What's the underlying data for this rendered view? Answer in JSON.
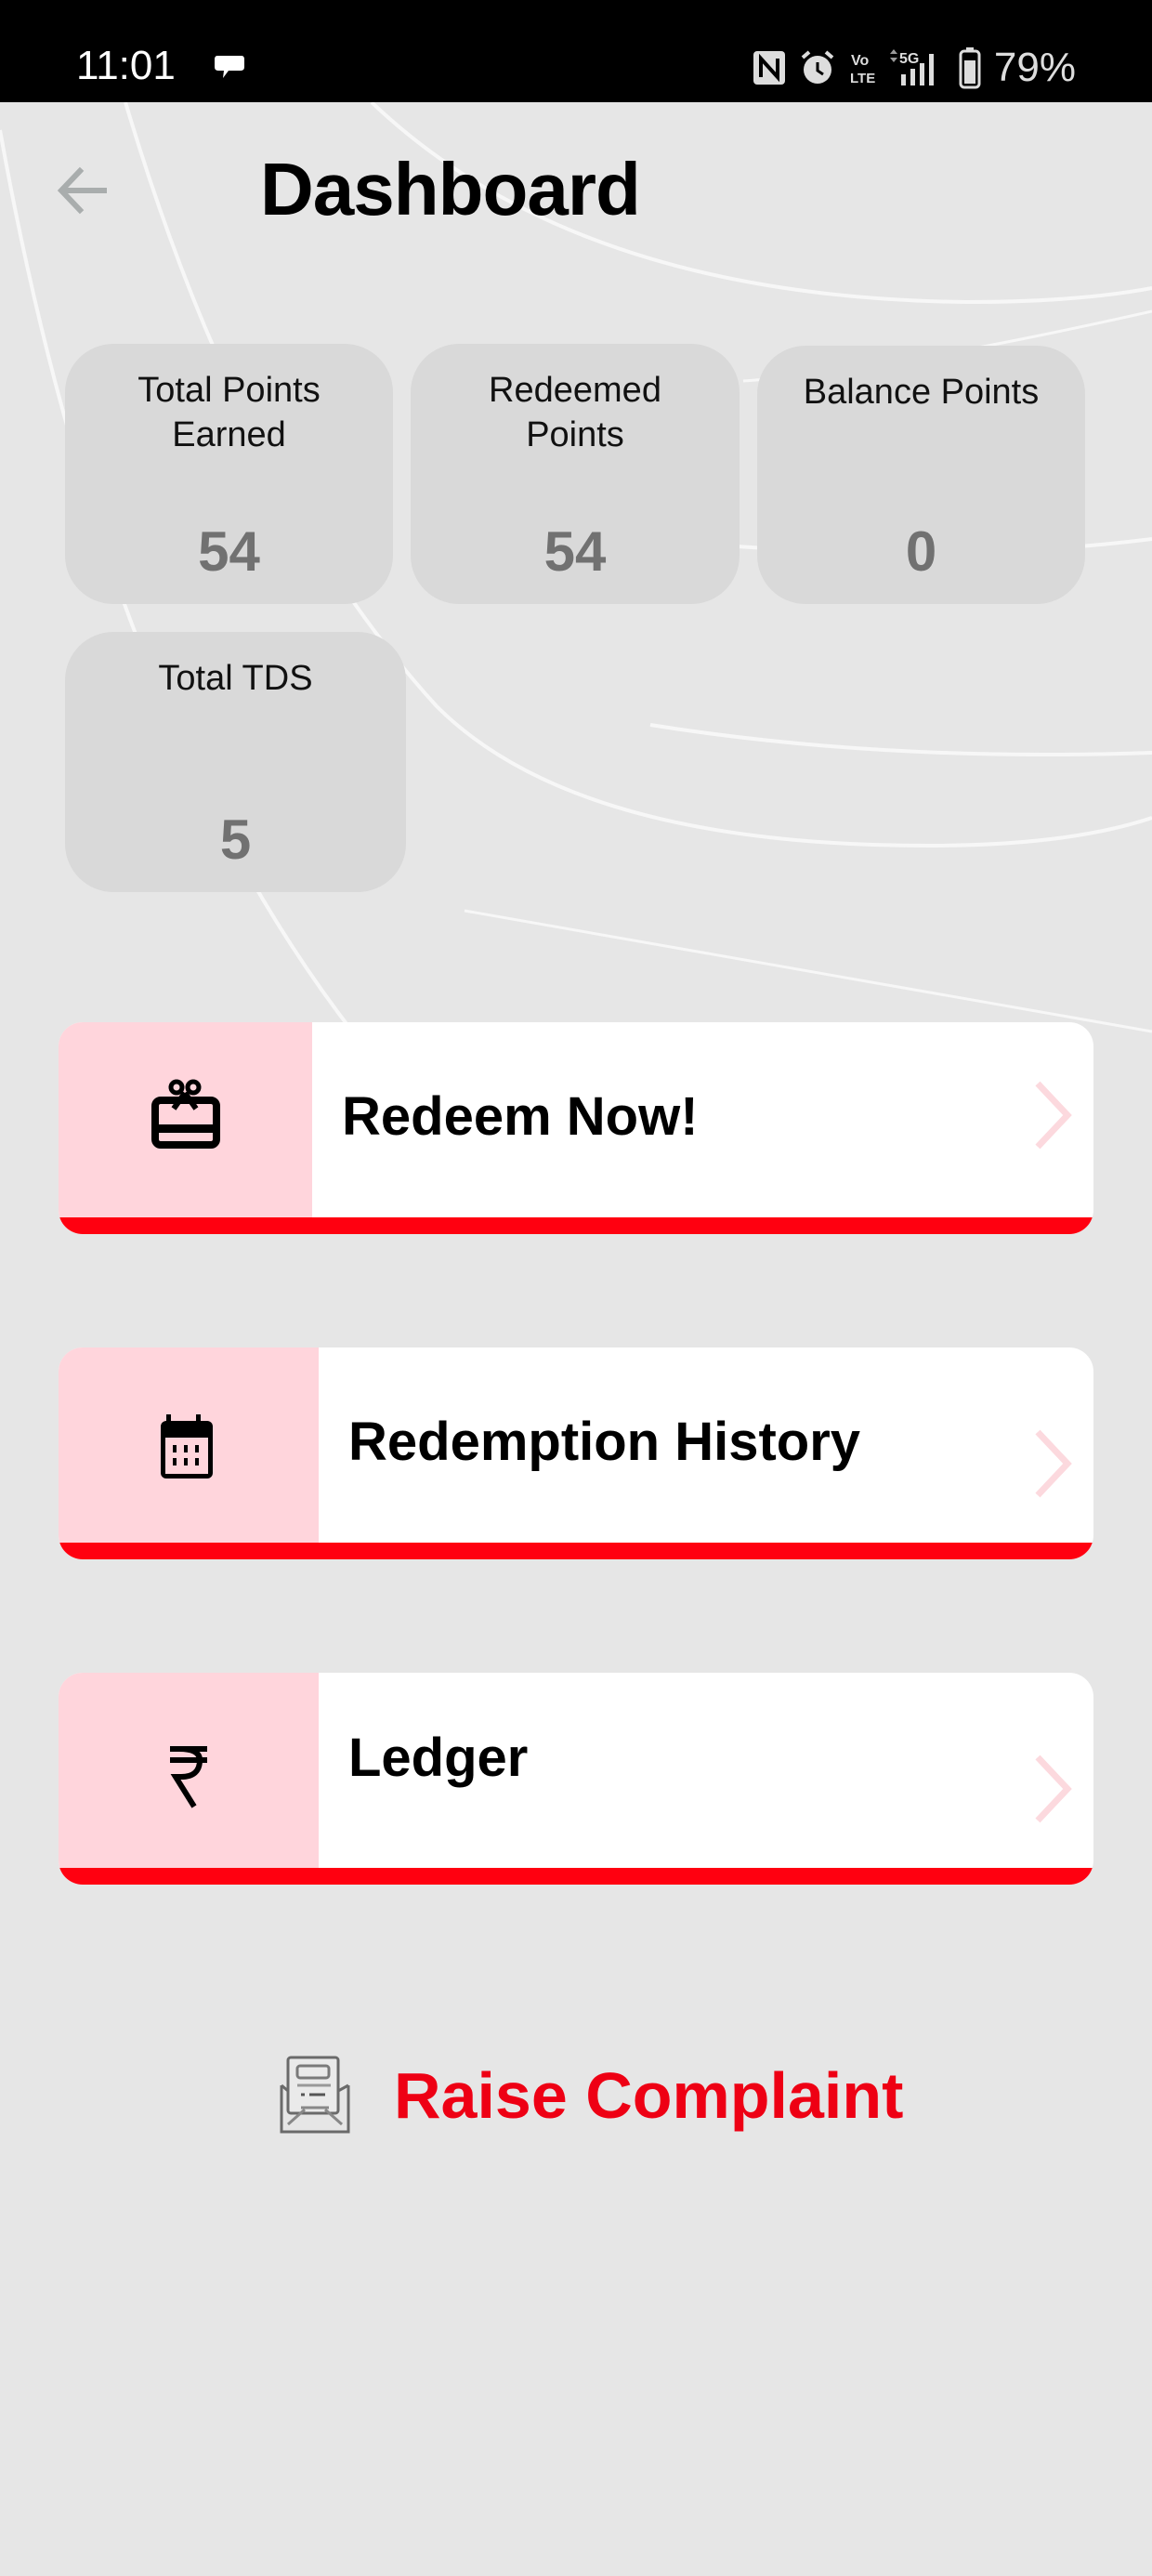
{
  "status_bar": {
    "time": "11:01",
    "battery_percent": "79%",
    "network": "5G",
    "volte": "Vo LTE",
    "icons": [
      "chat-notification-icon",
      "nfc-icon",
      "alarm-icon",
      "volte-icon",
      "signal-5g-icon",
      "battery-icon"
    ]
  },
  "header": {
    "back_icon": "arrow-left-icon",
    "title": "Dashboard"
  },
  "stats": [
    {
      "label": "Total Points Earned",
      "value": "54"
    },
    {
      "label": "Redeemed Points",
      "value": "54"
    },
    {
      "label": "Balance Points",
      "value": "0"
    },
    {
      "label": "Total TDS",
      "value": "5"
    }
  ],
  "actions": [
    {
      "label": "Redeem Now!",
      "icon": "gift-card-icon"
    },
    {
      "label": "Redemption History",
      "icon": "calendar-icon"
    },
    {
      "label": "Ledger",
      "icon": "rupee-icon"
    }
  ],
  "complaint": {
    "label": "Raise Complaint",
    "icon": "envelope-letter-icon"
  },
  "colors": {
    "accent_red": "#ff0010",
    "complaint_text": "#ee0014",
    "icon_panel_pink": "#ffd5dc",
    "card_gray": "#d9d9d9",
    "page_background": "#e6e6e6",
    "value_gray": "#717171"
  }
}
